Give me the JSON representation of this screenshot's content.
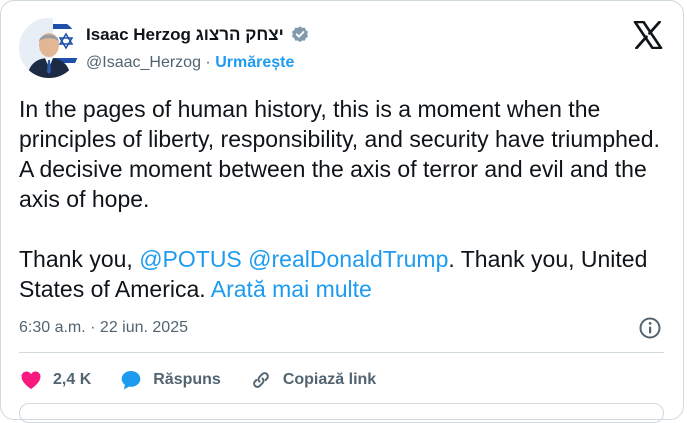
{
  "author": {
    "name": "Isaac Herzog יצחק הרצוג",
    "handle": "@Isaac_Herzog",
    "separator": "·",
    "follow_label": "Urmărește"
  },
  "tweet": {
    "paragraph1": "In the pages of human history, this is a moment when the principles of liberty, responsibility, and security have triumphed. A decisive moment between the axis of terror and evil and the axis of hope.",
    "thanks_prefix": "Thank you, ",
    "mention1": "@POTUS",
    "mention_space": " ",
    "mention2": "@realDonaldTrump",
    "thanks_suffix": ". Thank you, United States of America. ",
    "show_more": "Arată mai multe"
  },
  "meta": {
    "timestamp": "6:30 a.m. · 22 iun. 2025"
  },
  "actions": {
    "like_count": "2,4 K",
    "reply_label": "Răspuns",
    "copy_label": "Copiază link"
  },
  "colors": {
    "accent": "#1d9bf0",
    "heart": "#f91880",
    "text": "#0f1419",
    "secondary": "#536471",
    "border": "#cfd9de"
  },
  "icons": [
    "verified-icon",
    "x-logo-icon",
    "info-icon",
    "heart-icon",
    "reply-bubble-icon",
    "link-icon"
  ]
}
